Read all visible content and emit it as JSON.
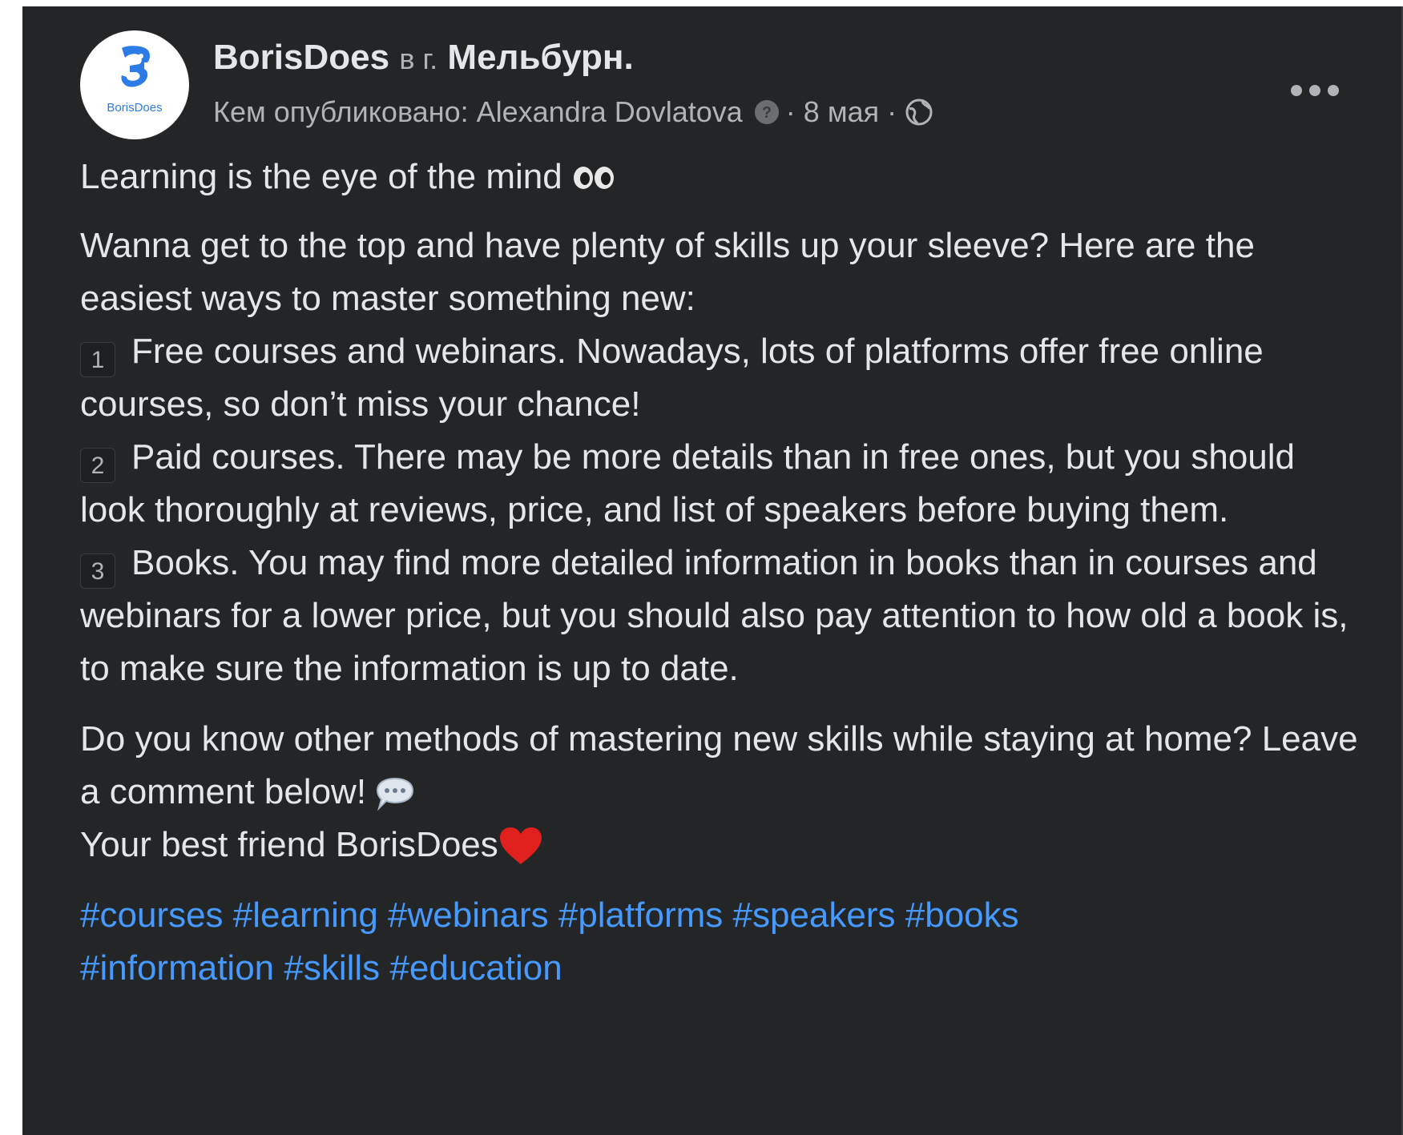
{
  "post": {
    "author": "BorisDoes",
    "in_label": "в г.",
    "location": "Мельбурн.",
    "published_by": "Кем опубликовано: Alexandra Dovlatova",
    "separator": "·",
    "date": "8 мая",
    "avatar_text": "BorisDoes",
    "icons": {
      "info": "question-circle-icon",
      "privacy": "globe-icon",
      "more": "more-horizontal-icon"
    },
    "colors": {
      "background": "#242526",
      "text": "#e4e6eb",
      "secondary_text": "#b0b3b8",
      "hashtag": "#4599ff"
    }
  },
  "content": {
    "line1": "Learning is the eye of the mind",
    "intro": "Wanna get to the top and have plenty of skills up your sleeve? Here are the easiest ways to master something new:",
    "items": [
      {
        "num": "1",
        "text": "Free courses and webinars. Nowadays, lots of platforms offer free online courses, so don’t miss your chance!"
      },
      {
        "num": "2",
        "text": "Paid courses. There may be more details than in free ones, but you should look thoroughly at reviews, price, and list of speakers before buying them."
      },
      {
        "num": "3",
        "text": "Books. You may find more detailed information in books than in courses and webinars for a lower price, but you should also pay attention to how old a book is, to make sure the information is up to date."
      }
    ],
    "question": "Do you know other methods of mastering new skills while staying at home? Leave a comment below!",
    "signoff": "Your best friend BorisDoes",
    "hashtags": [
      "#courses",
      "#learning",
      "#webinars",
      "#platforms",
      "#speakers",
      "#books",
      "#information",
      "#skills",
      "#education"
    ]
  }
}
